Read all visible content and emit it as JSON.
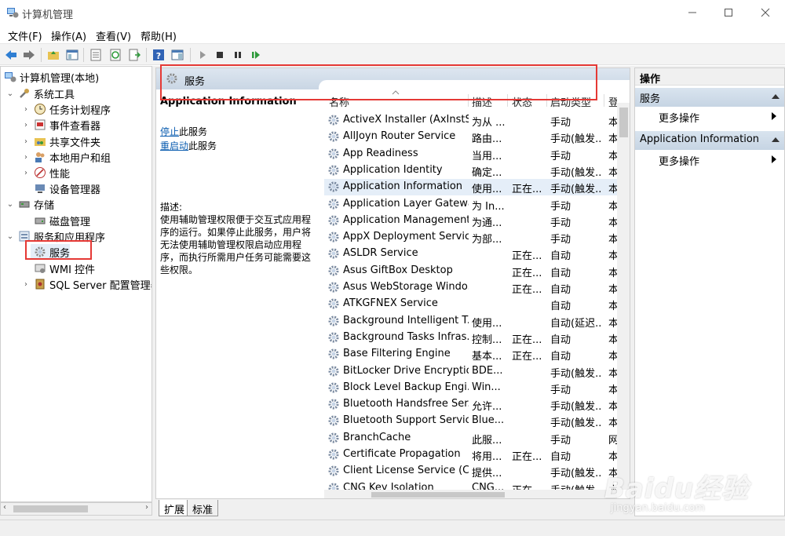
{
  "window": {
    "title": "计算机管理"
  },
  "menu": [
    "文件(F)",
    "操作(A)",
    "查看(V)",
    "帮助(H)"
  ],
  "tree": {
    "root": "计算机管理(本地)",
    "items": [
      {
        "label": "系统工具",
        "level": 1
      },
      {
        "label": "任务计划程序",
        "level": 2
      },
      {
        "label": "事件查看器",
        "level": 2
      },
      {
        "label": "共享文件夹",
        "level": 2
      },
      {
        "label": "本地用户和组",
        "level": 2
      },
      {
        "label": "性能",
        "level": 2
      },
      {
        "label": "设备管理器",
        "level": 2
      },
      {
        "label": "存储",
        "level": 1
      },
      {
        "label": "磁盘管理",
        "level": 2
      },
      {
        "label": "服务和应用程序",
        "level": 1
      },
      {
        "label": "服务",
        "level": 2
      },
      {
        "label": "WMI 控件",
        "level": 2
      },
      {
        "label": "SQL Server 配置管理器",
        "level": 2
      }
    ]
  },
  "center": {
    "header_title": "服务",
    "selected_service": "Application Information",
    "stop_link": "停止",
    "stop_suffix": "此服务",
    "restart_link": "重启动",
    "restart_suffix": "此服务",
    "description_label": "描述:",
    "description": "使用辅助管理权限便于交互式应用程序的运行。如果停止此服务，用户将无法使用辅助管理权限启动应用程序，而执行所需用户任务可能需要这些权限。",
    "columns": [
      "名称",
      "描述",
      "状态",
      "启动类型",
      "登"
    ],
    "services": [
      [
        "ActiveX Installer (AxInstSV)",
        "为从 ...",
        "",
        "手动",
        "本"
      ],
      [
        "AllJoyn Router Service",
        "路由...",
        "",
        "手动(触发...",
        "本"
      ],
      [
        "App Readiness",
        "当用...",
        "",
        "手动",
        "本"
      ],
      [
        "Application Identity",
        "确定...",
        "",
        "手动(触发...",
        "本"
      ],
      [
        "Application Information",
        "使用...",
        "正在...",
        "手动(触发...",
        "本"
      ],
      [
        "Application Layer Gatewa...",
        "为 In...",
        "",
        "手动",
        "本"
      ],
      [
        "Application Management",
        "为通...",
        "",
        "手动",
        "本"
      ],
      [
        "AppX Deployment Servic...",
        "为部...",
        "",
        "手动",
        "本"
      ],
      [
        "ASLDR Service",
        "",
        "正在...",
        "自动",
        "本"
      ],
      [
        "Asus GiftBox Desktop",
        "",
        "正在...",
        "自动",
        "本"
      ],
      [
        "Asus WebStorage Windo...",
        "",
        "正在...",
        "自动",
        "本"
      ],
      [
        "ATKGFNEX Service",
        "",
        "",
        "自动",
        "本"
      ],
      [
        "Background Intelligent T...",
        "使用...",
        "",
        "自动(延迟...",
        "本"
      ],
      [
        "Background Tasks Infras...",
        "控制...",
        "正在...",
        "自动",
        "本"
      ],
      [
        "Base Filtering Engine",
        "基本...",
        "正在...",
        "自动",
        "本"
      ],
      [
        "BitLocker Drive Encryptio...",
        "BDE...",
        "",
        "手动(触发...",
        "本"
      ],
      [
        "Block Level Backup Engi...",
        "Win...",
        "",
        "手动",
        "本"
      ],
      [
        "Bluetooth Handsfree Ser...",
        "允许...",
        "",
        "手动(触发...",
        "本"
      ],
      [
        "Bluetooth Support Service",
        "Blue...",
        "",
        "手动(触发...",
        "本"
      ],
      [
        "BranchCache",
        "此服...",
        "",
        "手动",
        "网"
      ],
      [
        "Certificate Propagation",
        "将用...",
        "正在...",
        "自动",
        "本"
      ],
      [
        "Client License Service (Cli...",
        "提供...",
        "",
        "手动(触发...",
        "本"
      ],
      [
        "CNG Key Isolation",
        "CNG...",
        "正在...",
        "手动(触发...",
        "本"
      ]
    ]
  },
  "tabs": [
    "扩展",
    "标准"
  ],
  "actions": {
    "header": "操作",
    "sections": [
      {
        "title": "服务",
        "item": "更多操作"
      },
      {
        "title": "Application Information",
        "item": "更多操作"
      }
    ]
  },
  "watermark": {
    "brand": "Baidu经验",
    "url": "jingyan.baidu.com"
  }
}
